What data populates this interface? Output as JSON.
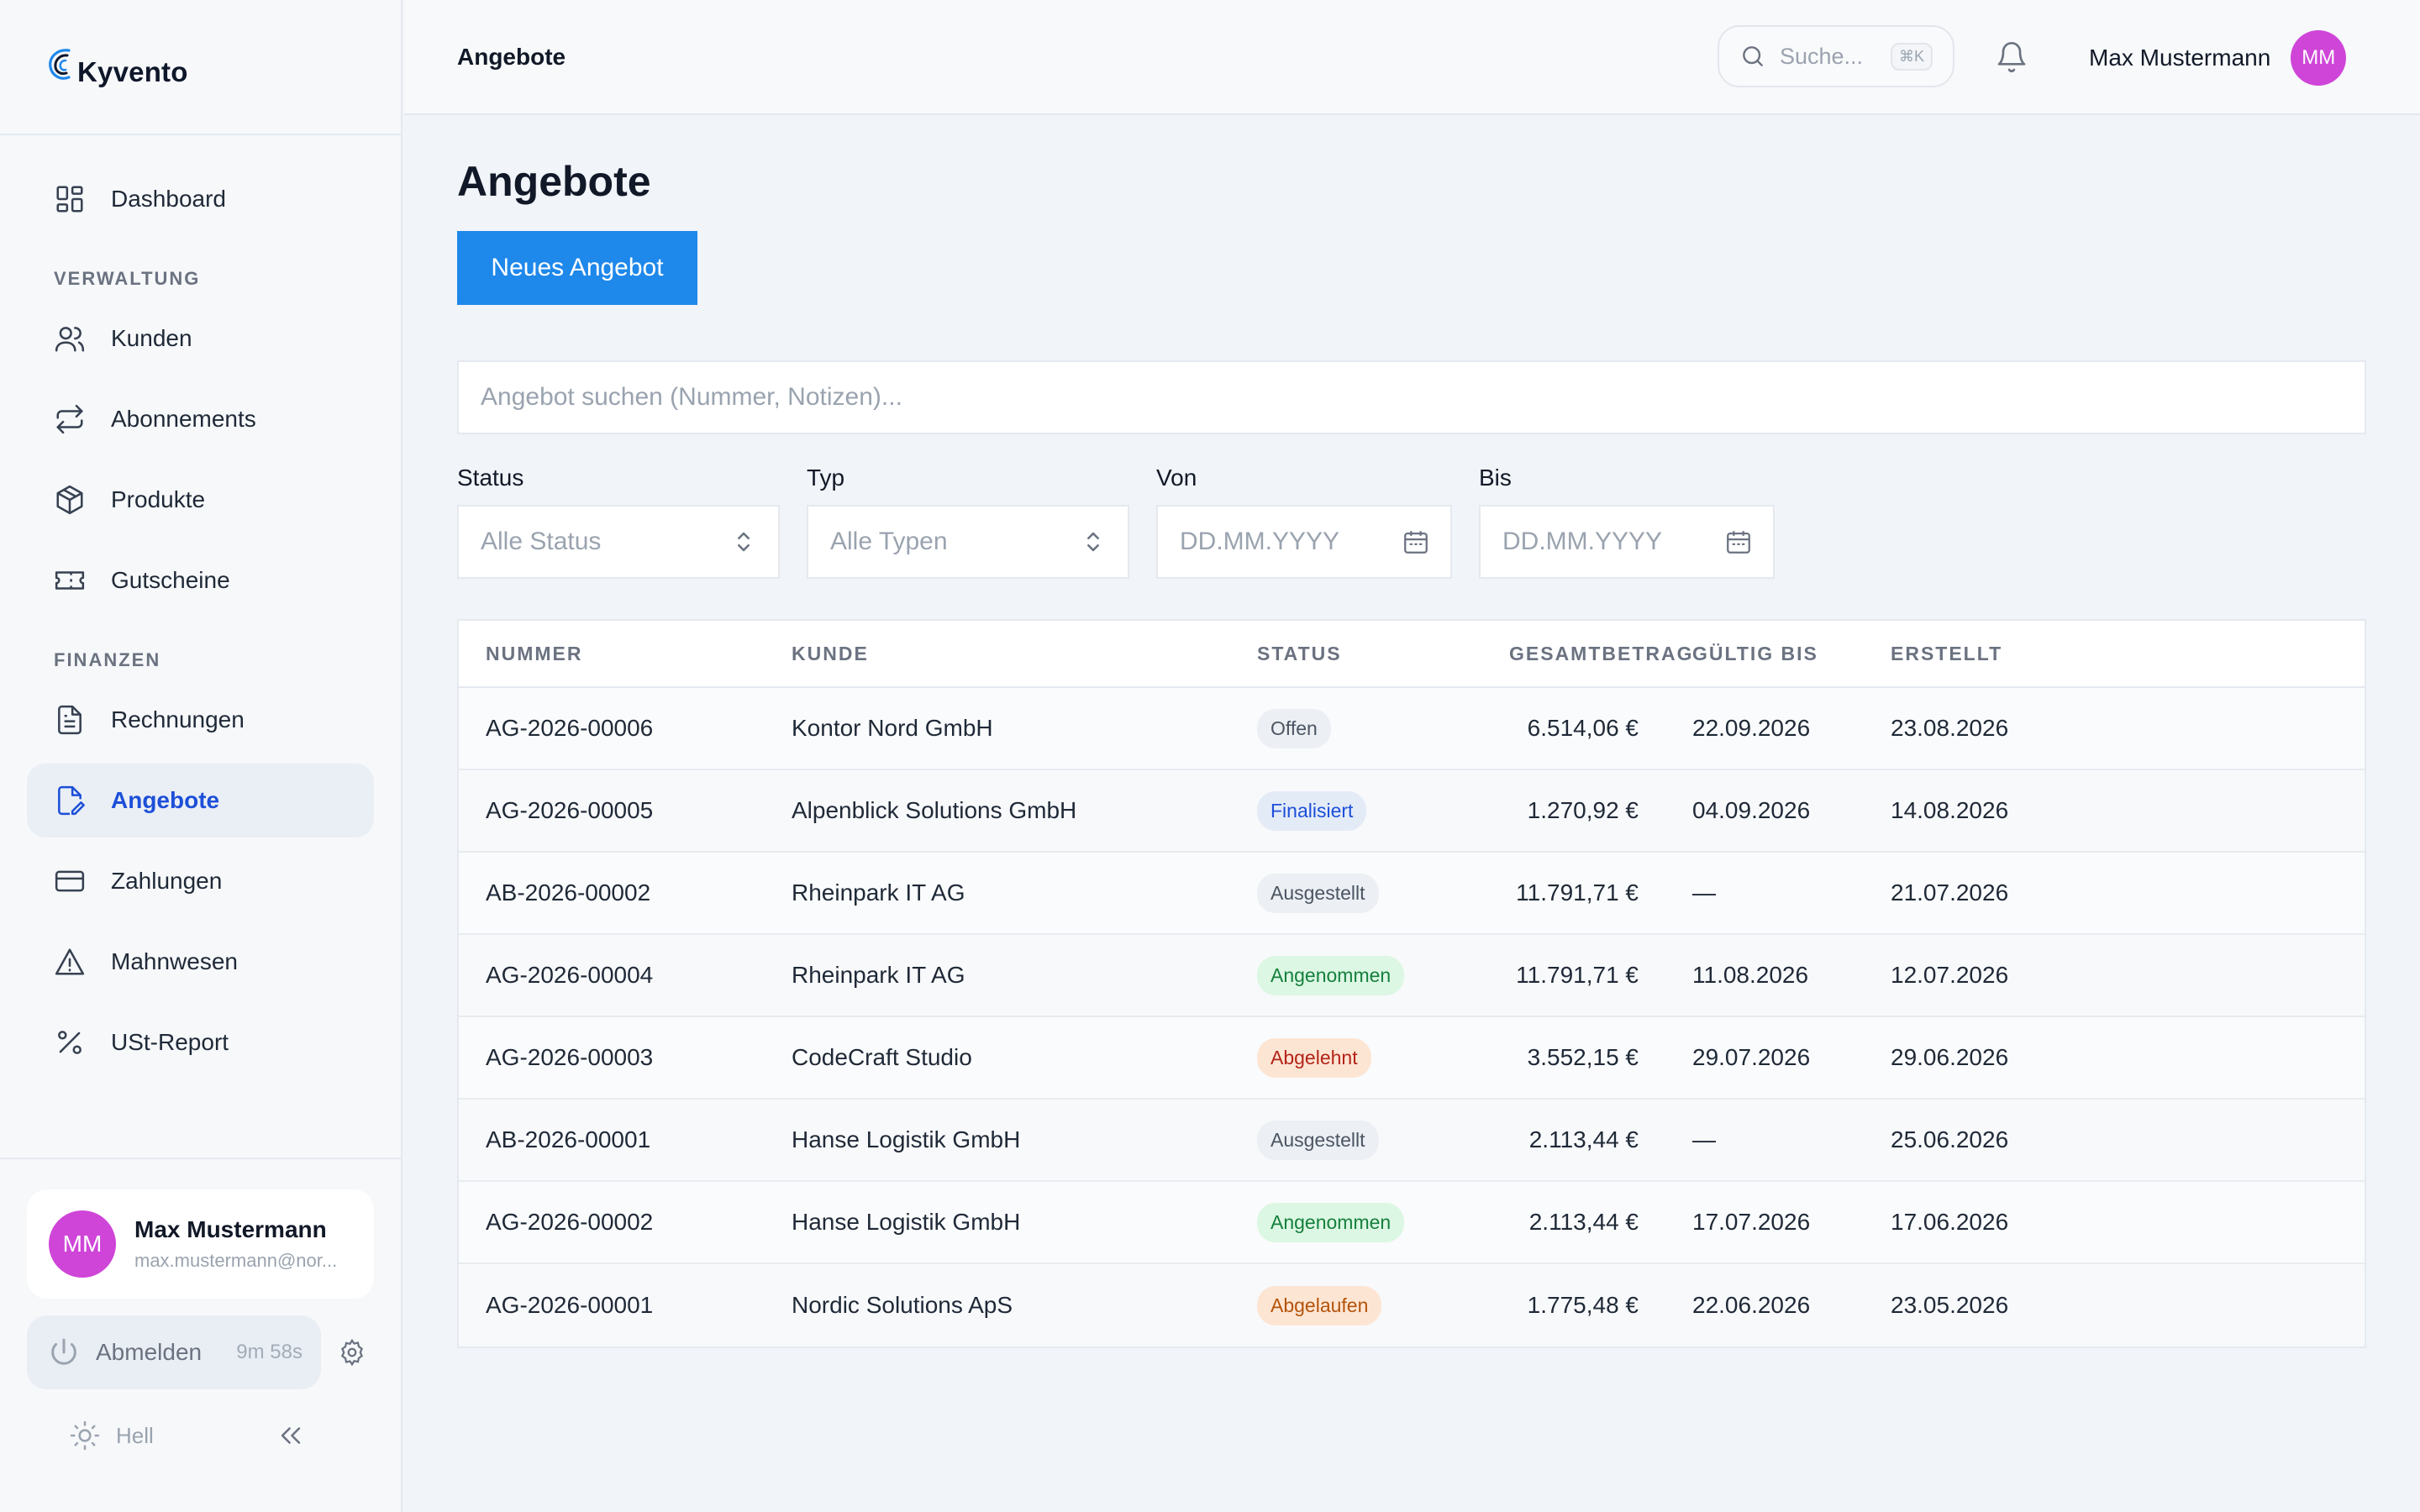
{
  "brand": {
    "name": "Kyvento"
  },
  "colors": {
    "accent": "#1e88eb",
    "nav_active": "#1d4fd8",
    "avatar": "#cf45d8"
  },
  "sidebar": {
    "dashboard": "Dashboard",
    "section_verwaltung": "VERWALTUNG",
    "kunden": "Kunden",
    "abonnements": "Abonnements",
    "produkte": "Produkte",
    "gutscheine": "Gutscheine",
    "section_finanzen": "FINANZEN",
    "rechnungen": "Rechnungen",
    "angebote": "Angebote",
    "zahlungen": "Zahlungen",
    "mahnwesen": "Mahnwesen",
    "ust_report": "USt-Report"
  },
  "user": {
    "initials": "MM",
    "name": "Max Mustermann",
    "email": "max.mustermann@nor..."
  },
  "session": {
    "logout_label": "Abmelden",
    "timer": "9m 58s"
  },
  "theme": {
    "label": "Hell"
  },
  "topbar": {
    "title": "Angebote",
    "search_placeholder": "Suche...",
    "search_shortcut": "⌘K"
  },
  "page": {
    "title": "Angebote",
    "new_button": "Neues Angebot",
    "search_placeholder": "Angebot suchen (Nummer, Notizen)..."
  },
  "filters": {
    "status": {
      "label": "Status",
      "value": "Alle Status"
    },
    "typ": {
      "label": "Typ",
      "value": "Alle Typen"
    },
    "von": {
      "label": "Von",
      "placeholder": "DD.MM.YYYY"
    },
    "bis": {
      "label": "Bis",
      "placeholder": "DD.MM.YYYY"
    }
  },
  "table": {
    "headers": [
      "NUMMER",
      "KUNDE",
      "STATUS",
      "GESAMTBETRAG",
      "GÜLTIG BIS",
      "ERSTELLT"
    ],
    "rows": [
      [
        "AG-2026-00006",
        "Kontor Nord GmbH",
        "Offen",
        "6.514,06 €",
        "22.09.2026",
        "23.08.2026"
      ],
      [
        "AG-2026-00005",
        "Alpenblick Solutions GmbH",
        "Finalisiert",
        "1.270,92 €",
        "04.09.2026",
        "14.08.2026"
      ],
      [
        "AB-2026-00002",
        "Rheinpark IT AG",
        "Ausgestellt",
        "11.791,71 €",
        "—",
        "21.07.2026"
      ],
      [
        "AG-2026-00004",
        "Rheinpark IT AG",
        "Angenommen",
        "11.791,71 €",
        "11.08.2026",
        "12.07.2026"
      ],
      [
        "AG-2026-00003",
        "CodeCraft Studio",
        "Abgelehnt",
        "3.552,15 €",
        "29.07.2026",
        "29.06.2026"
      ],
      [
        "AB-2026-00001",
        "Hanse Logistik GmbH",
        "Ausgestellt",
        "2.113,44 €",
        "—",
        "25.06.2026"
      ],
      [
        "AG-2026-00002",
        "Hanse Logistik GmbH",
        "Angenommen",
        "2.113,44 €",
        "17.07.2026",
        "17.06.2026"
      ],
      [
        "AG-2026-00001",
        "Nordic Solutions ApS",
        "Abgelaufen",
        "1.775,48 €",
        "22.06.2026",
        "23.05.2026"
      ]
    ]
  }
}
